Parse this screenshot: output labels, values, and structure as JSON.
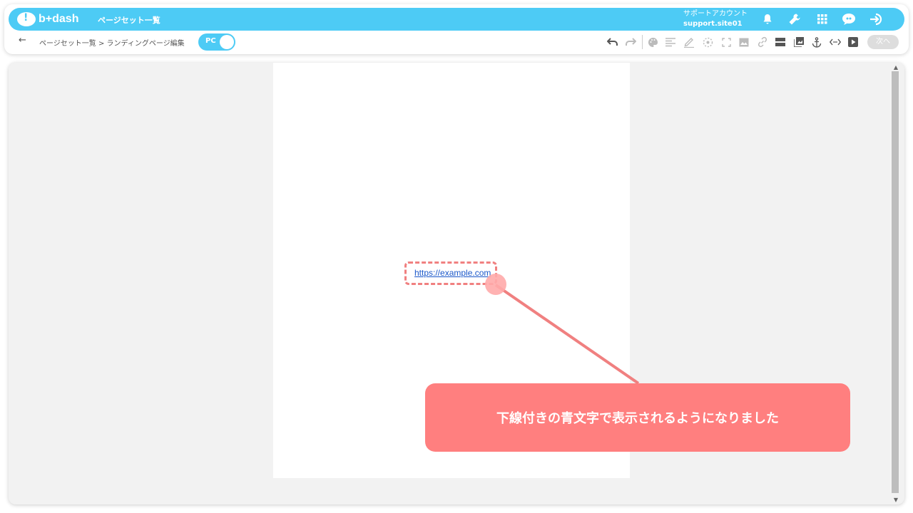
{
  "header": {
    "logo_text": "b+dash",
    "app_title": "ページセット一覧",
    "account_name": "サポートアカウント",
    "account_id": "support.site01",
    "icons": [
      "bell-icon",
      "wrench-icon",
      "apps-grid-icon",
      "chat-icon",
      "logout-icon"
    ]
  },
  "subbar": {
    "back_icon": "←",
    "breadcrumb": "ページセット一覧 > ランディングページ編集",
    "device_toggle_label": "PC",
    "tools": [
      "undo",
      "redo",
      "palette",
      "align-text",
      "pen",
      "circle-select",
      "fullscreen",
      "image",
      "link",
      "section",
      "gallery",
      "anchor",
      "code",
      "video"
    ],
    "next_label": "次へ"
  },
  "editor": {
    "link_text": "https://example.com"
  },
  "callout": {
    "text": "下線付きの青文字で表示されるようになりました"
  },
  "colors": {
    "brand": "#4dcbf5",
    "callout": "#ff7f7f",
    "link": "#1a57c9"
  }
}
